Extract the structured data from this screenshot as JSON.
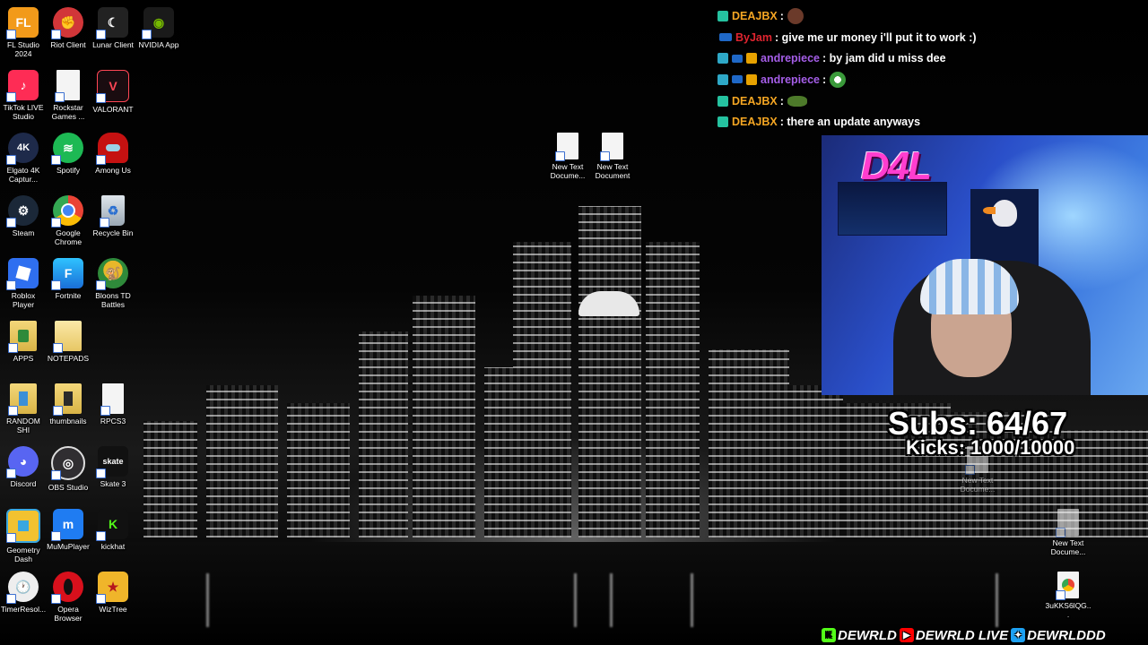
{
  "desktop": {
    "icons": [
      {
        "label": "FL Studio 2024",
        "icon": "fl-studio-icon",
        "color": "#f29a1a"
      },
      {
        "label": "Riot Client",
        "icon": "riot-client-icon",
        "color": "#d13639"
      },
      {
        "label": "Lunar Client",
        "icon": "lunar-client-icon",
        "color": "#222222"
      },
      {
        "label": "NVIDIA App",
        "icon": "nvidia-icon",
        "color": "#76b900"
      },
      {
        "label": "TikTok LIVE Studio",
        "icon": "tiktok-icon",
        "color": "#fe2c55"
      },
      {
        "label": "Rockstar Games ...",
        "icon": "file-icon",
        "color": "#f4f4f4"
      },
      {
        "label": "VALORANT",
        "icon": "valorant-icon",
        "color": "#ff4655"
      },
      {
        "label": "Elgato 4K Captur...",
        "icon": "elgato-icon",
        "color": "#1e2a4a"
      },
      {
        "label": "Spotify",
        "icon": "spotify-icon",
        "color": "#1db954"
      },
      {
        "label": "Among Us",
        "icon": "among-us-icon",
        "color": "#c51111"
      },
      {
        "label": "Steam",
        "icon": "steam-icon",
        "color": "#1b2838"
      },
      {
        "label": "Google Chrome",
        "icon": "chrome-icon",
        "color": "#4285f4"
      },
      {
        "label": "Recycle Bin",
        "icon": "recycle-bin-icon",
        "color": "#9aa7b3"
      },
      {
        "label": "Roblox Player",
        "icon": "roblox-icon",
        "color": "#2f6ff0"
      },
      {
        "label": "Fortnite",
        "icon": "fortnite-icon",
        "color": "#1fa3e8"
      },
      {
        "label": "Bloons TD Battles",
        "icon": "bloons-icon",
        "color": "#e8b72a"
      },
      {
        "label": "APPS",
        "icon": "folder-icon",
        "color": "#2f8a3a"
      },
      {
        "label": "NOTEPADS",
        "icon": "folder-icon",
        "color": "#f3d77a"
      },
      {
        "label": "RANDOM SHI",
        "icon": "folder-icon",
        "color": "#e6c14a"
      },
      {
        "label": "thumbnails",
        "icon": "folder-icon",
        "color": "#e6c14a"
      },
      {
        "label": "RPCS3",
        "icon": "file-icon",
        "color": "#f4f4f4"
      },
      {
        "label": "Discord",
        "icon": "discord-icon",
        "color": "#5865f2"
      },
      {
        "label": "OBS Studio",
        "icon": "obs-icon",
        "color": "#302e31"
      },
      {
        "label": "Skate 3",
        "icon": "skate-icon",
        "color": "#111111"
      },
      {
        "label": "Geometry Dash",
        "icon": "geometry-dash-icon",
        "color": "#f2c230"
      },
      {
        "label": "MuMuPlayer",
        "icon": "mumu-icon",
        "color": "#1f7cf2"
      },
      {
        "label": "kickhat",
        "icon": "kick-icon",
        "color": "#53fc18"
      },
      {
        "label": "TimerResol...",
        "icon": "clock-icon",
        "color": "#eeeeee"
      },
      {
        "label": "Opera Browser",
        "icon": "opera-icon",
        "color": "#d8101c"
      },
      {
        "label": "WizTree",
        "icon": "wiztree-icon",
        "color": "#f0b52a"
      },
      {
        "label": "New Text Docume...",
        "icon": "text-file-icon",
        "color": "#f4f4f4"
      },
      {
        "label": "New Text Document",
        "icon": "text-file-icon",
        "color": "#f4f4f4"
      },
      {
        "label": "New Text Docume...",
        "icon": "text-file-icon",
        "color": "#f4f4f4"
      },
      {
        "label": "New Text Docume...",
        "icon": "text-file-icon",
        "color": "#f4f4f4"
      },
      {
        "label": "3uKKS6lQG...",
        "icon": "chrome-html-file-icon",
        "color": "#f4f4f4"
      }
    ]
  },
  "chat": {
    "messages": [
      {
        "badges": [
          "sub"
        ],
        "user": "DEAJBX",
        "user_color": "#f5a623",
        "text": "",
        "emote": "emote-face"
      },
      {
        "badges": [
          "prime"
        ],
        "user": "ByJam",
        "user_color": "#e0242f",
        "text": "give me ur money i'll put it to work :)"
      },
      {
        "badges": [
          "mod",
          "prime",
          "crown"
        ],
        "user": "andrepiece",
        "user_color": "#a55ee8",
        "text": "by jam did u miss dee"
      },
      {
        "badges": [
          "mod",
          "prime",
          "crown"
        ],
        "user": "andrepiece",
        "user_color": "#a55ee8",
        "text": "",
        "emote": "emote-skull"
      },
      {
        "badges": [
          "sub"
        ],
        "user": "DEAJBX",
        "user_color": "#f5a623",
        "text": "",
        "emote": "emote-frog"
      },
      {
        "badges": [
          "sub"
        ],
        "user": "DEAJBX",
        "user_color": "#f5a623",
        "text": "there an update anyways"
      }
    ]
  },
  "overlay": {
    "cam_logo": "D4L",
    "subs": "Subs: 64/67",
    "kicks": "Kicks: 1000/10000",
    "socials": [
      {
        "platform": "kick",
        "icon": "kick-icon",
        "handle": "DEWRLD",
        "color": "#53fc18"
      },
      {
        "platform": "youtube",
        "icon": "youtube-icon",
        "handle": "DEWRLD LIVE",
        "color": "#ff0000"
      },
      {
        "platform": "twitter",
        "icon": "twitter-icon",
        "handle": "DEWRLDDD",
        "color": "#1da1f2"
      }
    ]
  }
}
